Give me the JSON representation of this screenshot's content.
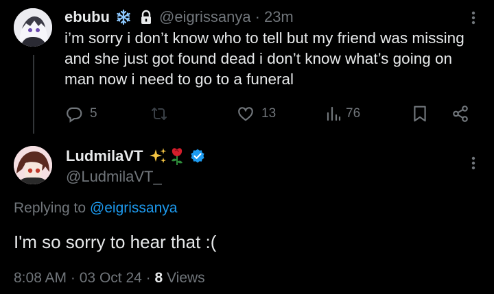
{
  "parent_tweet": {
    "display_name": "ebubu",
    "handle": "@eigrissanya",
    "separator": "·",
    "time": "23m",
    "text": "i’m sorry i don’t know who to tell but my friend was missing and she just got found dead i don’t know what’s going on man now i need to go to a funeral",
    "actions": {
      "reply_count": "5",
      "retweet_count": "",
      "like_count": "13",
      "views_count": "76"
    }
  },
  "reply_tweet": {
    "display_name": "LudmilaVT",
    "handle": "@LudmilaVT_",
    "replying_prefix": "Replying to",
    "replying_to": "@eigrissanya",
    "text": "I'm so sorry to hear that :(",
    "time": "8:08 AM",
    "separator": "·",
    "date": "03 Oct 24",
    "views_count": "8",
    "views_label": "Views"
  },
  "icons": {
    "parent_badges": [
      "snowflake-icon",
      "lock-icon"
    ],
    "reply_badges": [
      "sparkles-icon",
      "rose-icon",
      "verified-badge-icon"
    ],
    "actions": [
      "reply-icon",
      "retweet-icon",
      "like-icon",
      "views-icon",
      "bookmark-icon",
      "share-icon"
    ]
  },
  "colors": {
    "background": "#000000",
    "text_primary": "#e7e9ea",
    "text_secondary": "#71767b",
    "link": "#1d9bf0",
    "verified": "#1d9bf0",
    "snowflake": "#8ec9ff",
    "rose": "#d31d2b"
  }
}
